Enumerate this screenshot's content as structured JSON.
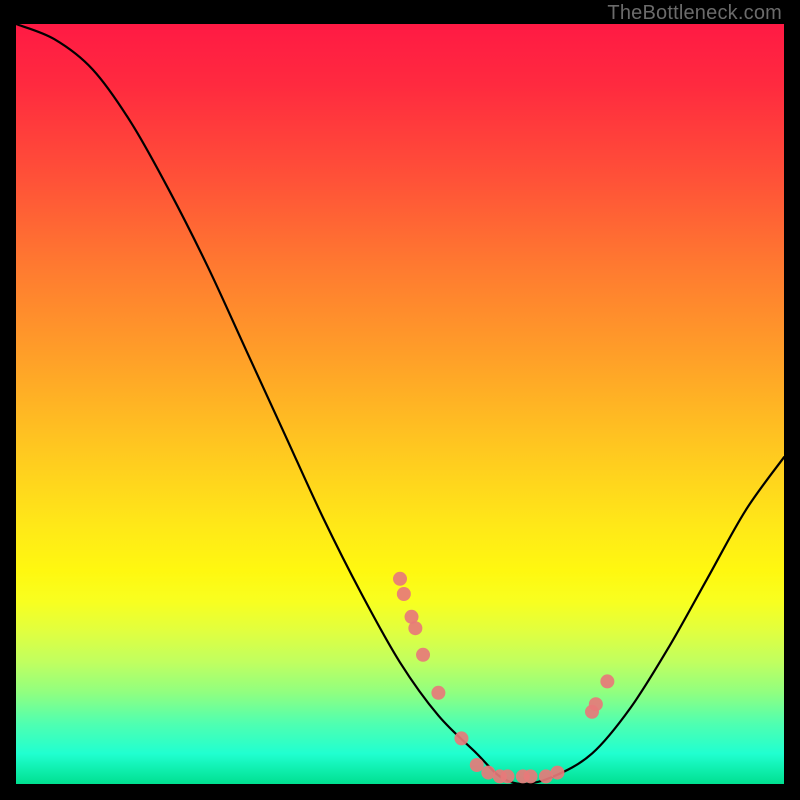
{
  "watermark": "TheBottleneck.com",
  "chart_data": {
    "type": "line",
    "title": "",
    "xlabel": "",
    "ylabel": "",
    "xlim": [
      0,
      100
    ],
    "ylim": [
      0,
      100
    ],
    "series": [
      {
        "name": "bottleneck-curve",
        "x": [
          0,
          5,
          10,
          15,
          20,
          25,
          30,
          35,
          40,
          45,
          50,
          55,
          60,
          63,
          66,
          70,
          75,
          80,
          85,
          90,
          95,
          100
        ],
        "y": [
          100,
          98,
          94,
          87,
          78,
          68,
          57,
          46,
          35,
          25,
          16,
          9,
          4,
          1,
          0,
          1,
          4,
          10,
          18,
          27,
          36,
          43
        ]
      }
    ],
    "markers": {
      "name": "highlight-points",
      "color": "#e77a7a",
      "x": [
        50.0,
        50.5,
        51.5,
        52.0,
        53.0,
        55.0,
        58.0,
        60.0,
        61.5,
        63.0,
        64.0,
        66.0,
        67.0,
        69.0,
        70.5,
        75.0,
        75.5,
        77.0
      ],
      "y": [
        27.0,
        25.0,
        22.0,
        20.5,
        17.0,
        12.0,
        6.0,
        2.5,
        1.5,
        1.0,
        1.0,
        1.0,
        1.0,
        1.0,
        1.5,
        9.5,
        10.5,
        13.5
      ]
    },
    "gradient_background": {
      "top_color": "#ff1a44",
      "mid_color": "#ffe818",
      "bottom_color": "#00e090"
    }
  }
}
